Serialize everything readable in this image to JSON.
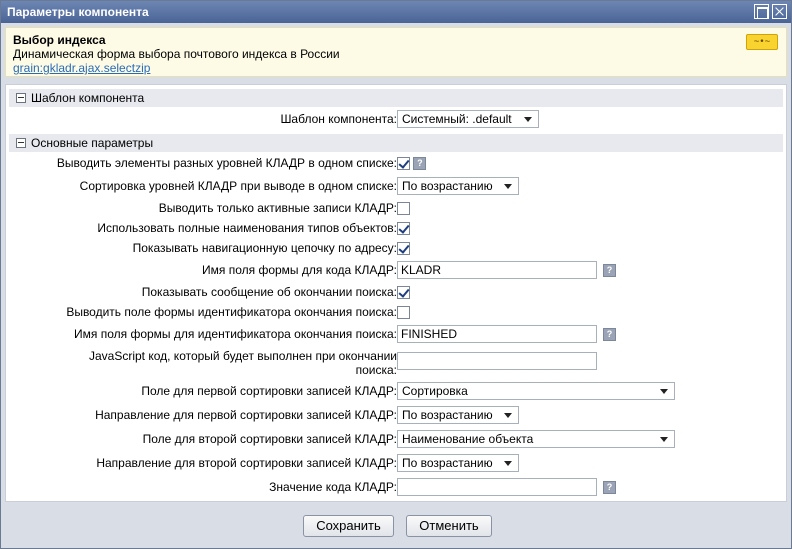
{
  "window": {
    "title": "Параметры компонента"
  },
  "component": {
    "name": "Выбор индекса",
    "description": "Динамическая форма выбора почтового индекса в России",
    "link": "grain:gkladr.ajax.selectzip",
    "badge": "~•~"
  },
  "sections": {
    "template": "Шаблон компонента",
    "basic": "Основные параметры"
  },
  "params": {
    "template": {
      "label": "Шаблон компонента:",
      "value": "Системный: .default"
    },
    "one_list": {
      "label": "Выводить элементы разных уровней КЛАДР в одном списке:",
      "checked": true
    },
    "sort_levels": {
      "label": "Сортировка уровней КЛАДР при выводе в одном списке:",
      "value": "По возрастанию"
    },
    "only_active": {
      "label": "Выводить только активные записи КЛАДР:",
      "checked": false
    },
    "full_names": {
      "label": "Использовать полные наименования типов объектов:",
      "checked": true
    },
    "nav_chain": {
      "label": "Показывать навигационную цепочку по адресу:",
      "checked": true
    },
    "field_code": {
      "label": "Имя поля формы для кода КЛАДР:",
      "value": "KLADR"
    },
    "show_msg": {
      "label": "Показывать сообщение об окончании поиска:",
      "checked": true
    },
    "show_finish_field": {
      "label": "Выводить поле формы идентификатора окончания поиска:",
      "checked": false
    },
    "finish_field_name": {
      "label": "Имя поля формы для идентификатора окончания поиска:",
      "value": "FINISHED"
    },
    "js_code": {
      "label": "JavaScript код, который будет выполнен при окончании поиска:",
      "value": ""
    },
    "sort1_field": {
      "label": "Поле для первой сортировки записей КЛАДР:",
      "value": "Сортировка"
    },
    "sort1_dir": {
      "label": "Направление для первой сортировки записей КЛАДР:",
      "value": "По возрастанию"
    },
    "sort2_field": {
      "label": "Поле для второй сортировки записей КЛАДР:",
      "value": "Наименование объекта"
    },
    "sort2_dir": {
      "label": "Направление для второй сортировки записей КЛАДР:",
      "value": "По возрастанию"
    },
    "code_value": {
      "label": "Значение кода КЛАДР:",
      "value": ""
    }
  },
  "help_glyph": "?",
  "buttons": {
    "save": "Сохранить",
    "cancel": "Отменить"
  }
}
